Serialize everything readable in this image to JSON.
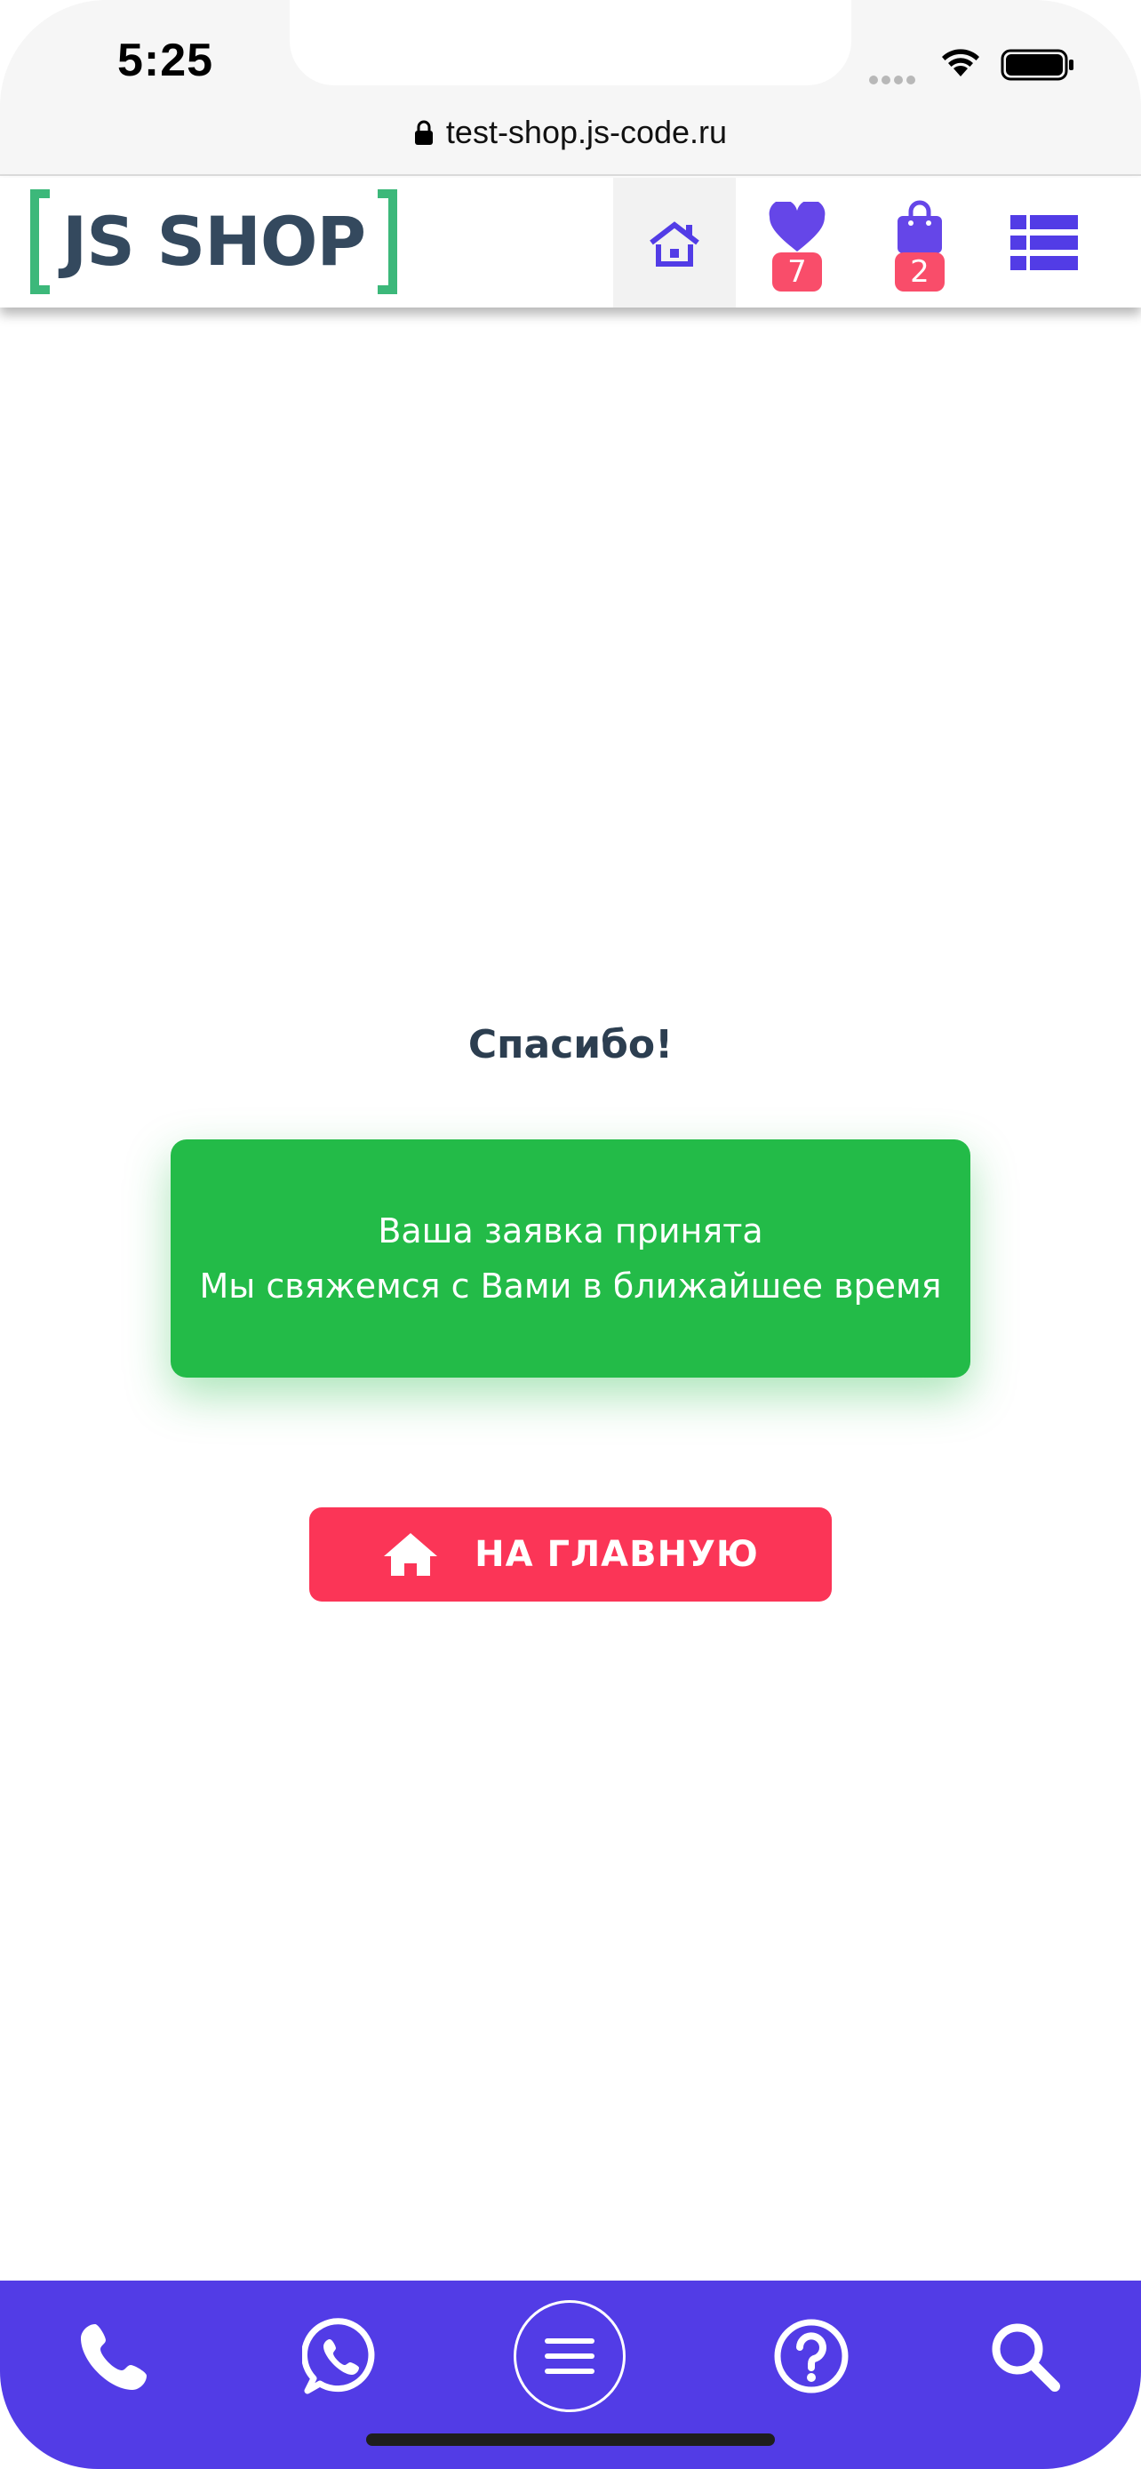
{
  "status_bar": {
    "time": "5:25",
    "icons": [
      "cellular-signal-icon",
      "wifi-icon",
      "battery-icon"
    ]
  },
  "browser": {
    "url": "test-shop.js-code.ru",
    "icons": [
      "lock-icon"
    ]
  },
  "header": {
    "logo_text": "JS SHOP",
    "logo_colors": {
      "bracket": "#3cb87a",
      "text": "#34495e"
    },
    "nav": [
      {
        "name": "home",
        "icon": "home-icon",
        "active": true
      },
      {
        "name": "favorites",
        "icon": "heart-icon",
        "badge": "7"
      },
      {
        "name": "cart",
        "icon": "shopping-bag-icon",
        "badge": "2"
      },
      {
        "name": "catalog",
        "icon": "list-icon"
      }
    ],
    "accent_color": "#523ce6",
    "badge_color": "#f94d6a"
  },
  "main": {
    "title": "Спасибо!",
    "message_lines": [
      "Ваша заявка принята",
      "Мы свяжемся с Вами в ближайшее время"
    ],
    "message_color": "#23bb48",
    "home_button": {
      "label": "НА ГЛАВНУЮ",
      "icon": "home-icon",
      "color": "#fb3557"
    }
  },
  "bottom_bar": {
    "color": "#523ce6",
    "items": [
      {
        "name": "phone",
        "icon": "phone-icon"
      },
      {
        "name": "whatsapp",
        "icon": "whatsapp-icon"
      },
      {
        "name": "menu",
        "icon": "hamburger-menu-icon"
      },
      {
        "name": "help",
        "icon": "question-icon"
      },
      {
        "name": "search",
        "icon": "search-icon"
      }
    ]
  }
}
